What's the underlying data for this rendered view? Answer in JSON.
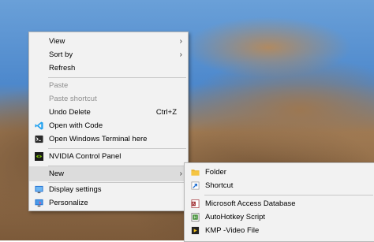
{
  "main_menu": {
    "items": [
      {
        "label": "View",
        "submenu": true
      },
      {
        "label": "Sort by",
        "submenu": true
      },
      {
        "label": "Refresh"
      },
      {
        "label": "Paste",
        "disabled": true
      },
      {
        "label": "Paste shortcut",
        "disabled": true
      },
      {
        "label": "Undo Delete",
        "shortcut": "Ctrl+Z"
      },
      {
        "label": "Open with Code",
        "icon": "vscode-icon"
      },
      {
        "label": "Open Windows Terminal here",
        "icon": "terminal-icon"
      },
      {
        "label": "NVIDIA Control Panel",
        "icon": "nvidia-icon"
      },
      {
        "label": "New",
        "submenu": true
      },
      {
        "label": "Display settings",
        "icon": "display-icon"
      },
      {
        "label": "Personalize",
        "icon": "personalize-icon"
      }
    ],
    "arrow_glyph": "›"
  },
  "new_submenu": {
    "items": [
      {
        "label": "Folder",
        "icon": "folder-icon"
      },
      {
        "label": "Shortcut",
        "icon": "shortcut-icon"
      },
      {
        "label": "Microsoft Access Database",
        "icon": "access-icon"
      },
      {
        "label": "AutoHotkey Script",
        "icon": "autohotkey-icon"
      },
      {
        "label": "KMP -Video File",
        "icon": "kmp-video-icon"
      }
    ]
  },
  "colors": {
    "menu_bg": "#f2f2f2",
    "hover_bg": "#dcdcdc",
    "disabled_text": "#8e8e8e",
    "vscode_blue": "#23a2f0",
    "nvidia_green": "#76b900",
    "folder_yellow": "#f5c542",
    "access_red": "#a4373a"
  }
}
